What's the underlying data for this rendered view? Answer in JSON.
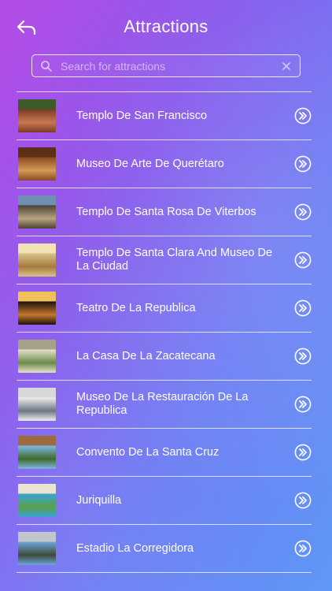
{
  "header": {
    "title": "Attractions",
    "back_icon": "back-arrow-icon"
  },
  "search": {
    "placeholder": "Search for attractions",
    "value": "",
    "icon": "search-icon",
    "clear_icon": "close-icon"
  },
  "attractions": [
    {
      "label": "Templo De San Francisco",
      "thumb": [
        "#7a3b25",
        "#c9774e",
        "#3c5a2a"
      ]
    },
    {
      "label": "Museo De Arte De Querétaro",
      "thumb": [
        "#8a4a24",
        "#d49a55",
        "#5b2f16"
      ]
    },
    {
      "label": "Templo De Santa Rosa De Viterbos",
      "thumb": [
        "#4a4238",
        "#b9a27e",
        "#6f8fb3"
      ]
    },
    {
      "label": "Templo De Santa Clara And Museo De La Ciudad",
      "thumb": [
        "#d9c38a",
        "#a57b3e",
        "#f2e3b5"
      ]
    },
    {
      "label": "Teatro De La Republica",
      "thumb": [
        "#1d120a",
        "#c2782b",
        "#f0c05a"
      ]
    },
    {
      "label": "La Casa De La Zacatecana",
      "thumb": [
        "#e7e1c9",
        "#6b8a4a",
        "#a7a08a"
      ]
    },
    {
      "label": "Museo De La Restauración De La Republica",
      "thumb": [
        "#eeeeee",
        "#6b7680",
        "#d8d8d8"
      ]
    },
    {
      "label": "Convento De La Santa Cruz",
      "thumb": [
        "#7fb7e6",
        "#3f6b2a",
        "#9c6b3e"
      ]
    },
    {
      "label": "Juriquilla",
      "thumb": [
        "#3aa3d6",
        "#5aa04a",
        "#e9e3d0"
      ]
    },
    {
      "label": "Estadio La Corregidora",
      "thumb": [
        "#6ea6d8",
        "#3d4a3a",
        "#c0c6cc"
      ]
    }
  ],
  "row_action_icon": "double-chevron-right-circle-icon",
  "colors": {
    "gradient_start": "#b64be6",
    "gradient_end": "#5f98f7",
    "text": "#ffffff"
  }
}
